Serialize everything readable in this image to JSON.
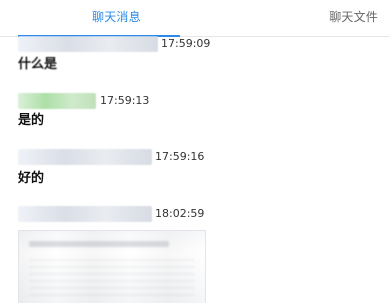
{
  "tabs": {
    "chat": "聊天消息",
    "files": "聊天文件"
  },
  "messages": [
    {
      "time": "17:59:09",
      "text": "什么是"
    },
    {
      "time": "17:59:13",
      "text": "是的"
    },
    {
      "time": "17:59:16",
      "text": "好的"
    },
    {
      "time": "18:02:59"
    }
  ],
  "colors": {
    "accent": "#2c8be8",
    "tab_inactive": "#666666",
    "divider": "#e6e6e6"
  }
}
